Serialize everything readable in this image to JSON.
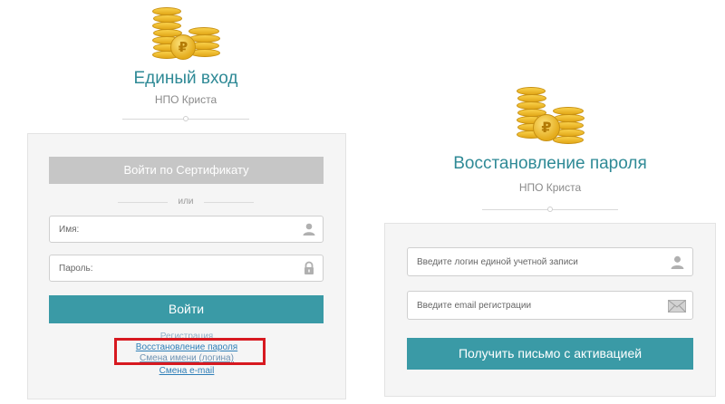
{
  "login": {
    "title": "Единый вход",
    "subtitle": "НПО Криста",
    "certificate_button": "Войти по Сертификату",
    "or_label": "или",
    "username_placeholder": "Имя:",
    "password_placeholder": "Пароль:",
    "login_button": "Войти",
    "links": {
      "register": "Регистрация",
      "restore_password": "Восстановление пароля",
      "change_name": "Смена имени (логина)",
      "change_email": "Смена e-mail"
    },
    "coin_symbol": "₽"
  },
  "recovery": {
    "title": "Восстановление пароля",
    "subtitle": "НПО Криста",
    "login_placeholder": "Введите логин единой учетной записи",
    "email_placeholder": "Введите email регистрации",
    "submit_button": "Получить письмо с активацией",
    "coin_symbol": "₽"
  },
  "colors": {
    "accent": "#3a9aa6",
    "title": "#2f8a96",
    "highlight": "#d71920",
    "link": "#2f7fb8",
    "coin": "#f2c233"
  },
  "icons": [
    "coins-logo-icon",
    "user-icon",
    "lock-icon",
    "envelope-icon"
  ]
}
